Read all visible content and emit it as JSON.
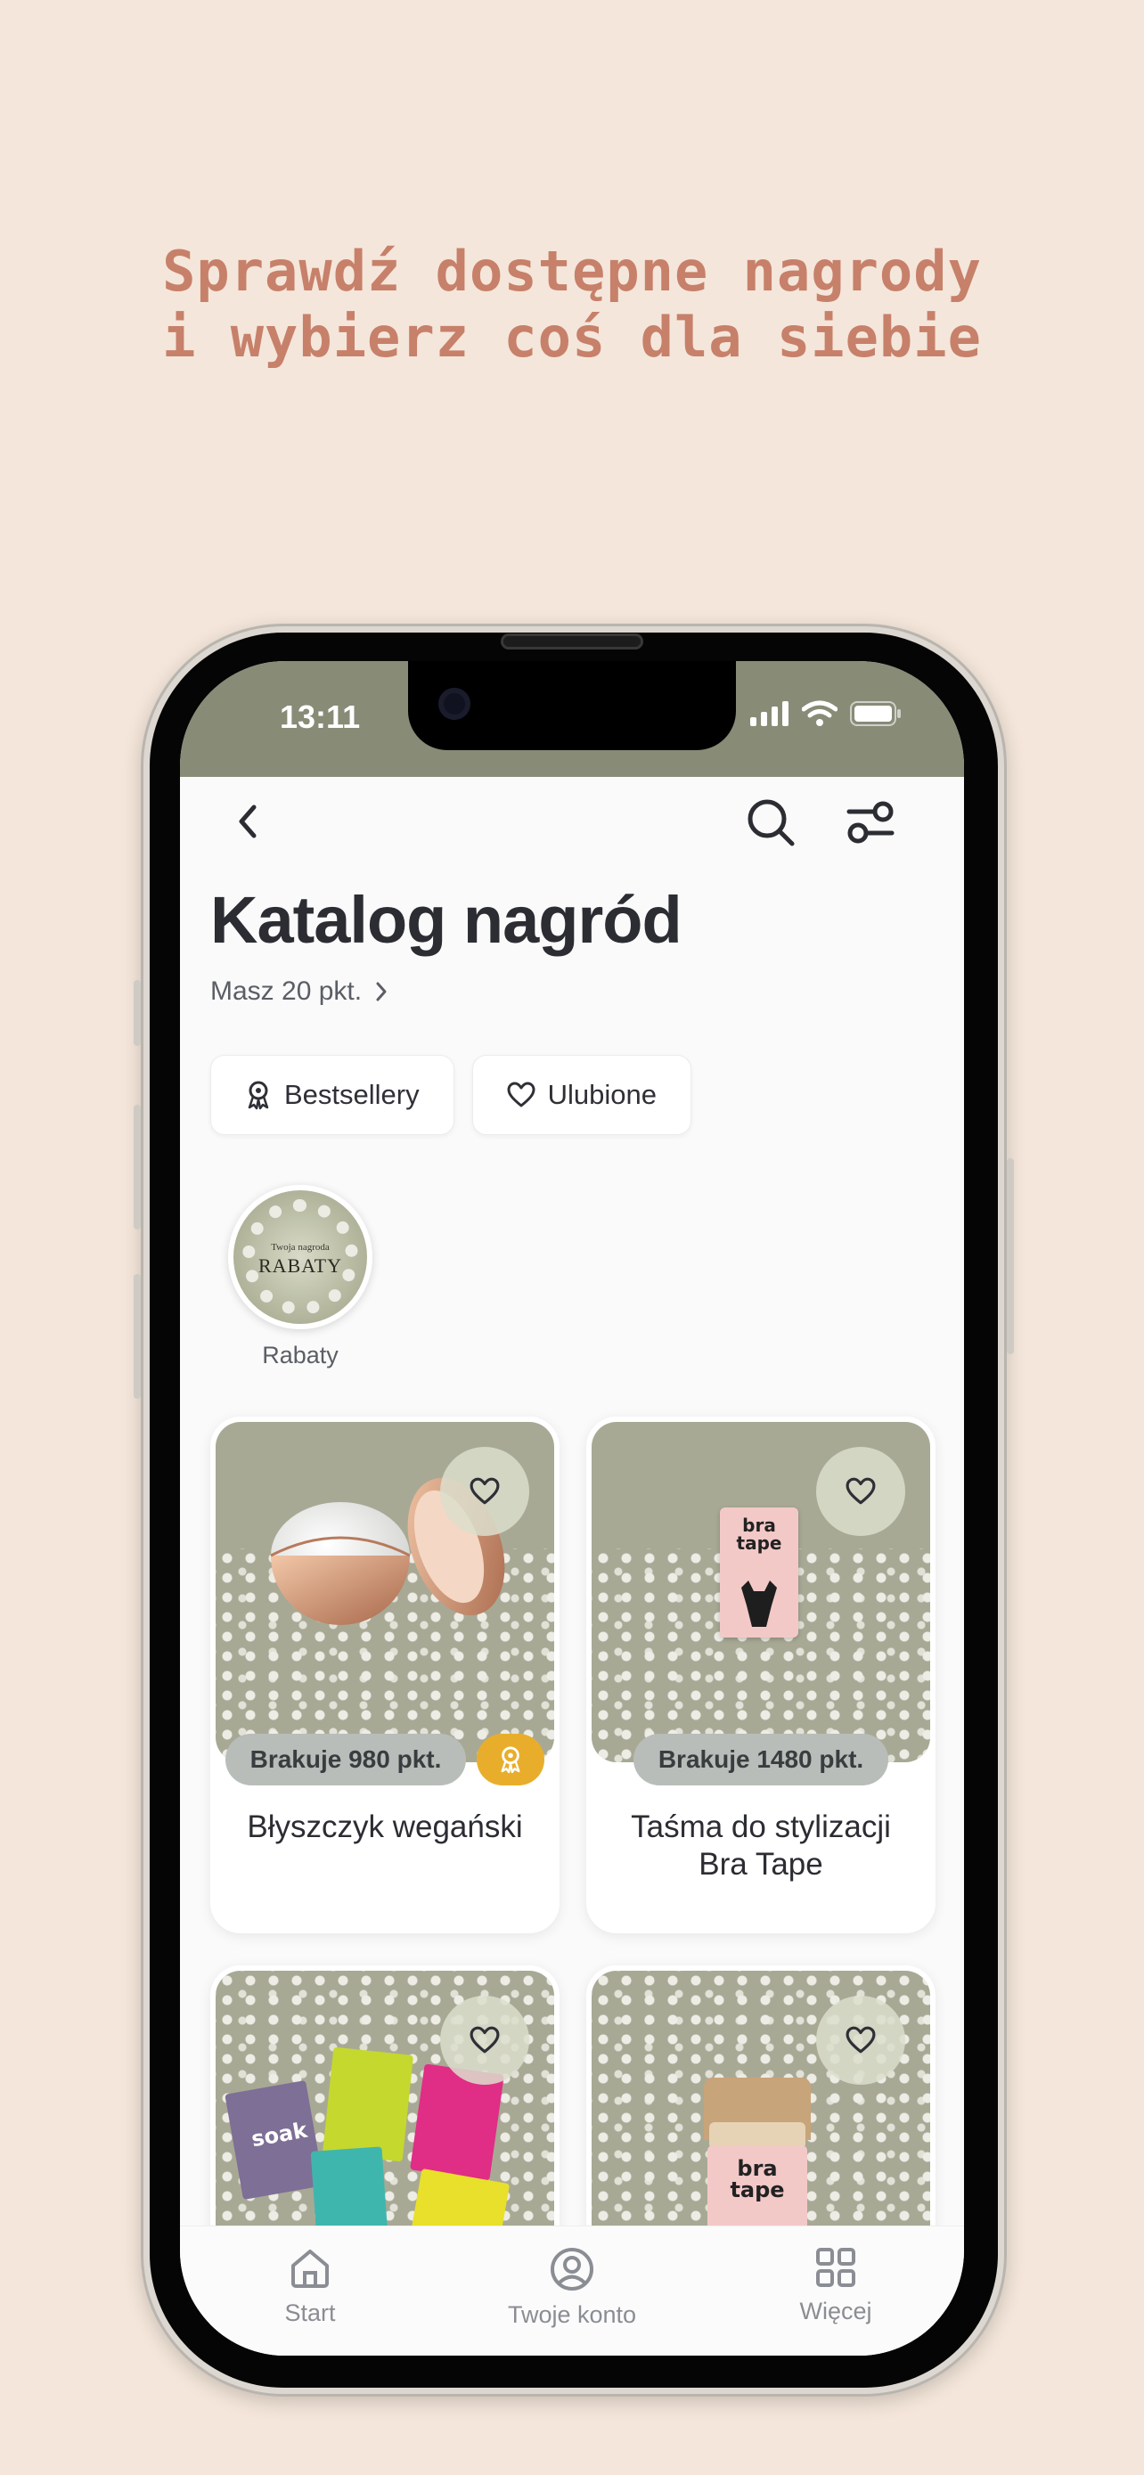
{
  "promo": {
    "line1": "Sprawdź dostępne nagrody",
    "line2": "i wybierz coś dla siebie"
  },
  "status_bar": {
    "time": "13:11"
  },
  "header": {
    "title": "Katalog nagród",
    "points_text": "Masz 20 pkt."
  },
  "filters": [
    {
      "label": "Bestsellery",
      "icon": "award-ribbon-icon"
    },
    {
      "label": "Ulubione",
      "icon": "heart-icon"
    }
  ],
  "categories": [
    {
      "label": "Rabaty",
      "image_small_text": "Twoja nagroda",
      "image_big_text": "RABATY"
    }
  ],
  "products": [
    {
      "title": "Błyszczyk wegański",
      "missing": "Brakuje 980 pkt.",
      "bestseller": true
    },
    {
      "title": "Taśma do stylizacji Bra Tape",
      "missing": "Brakuje 1480 pkt.",
      "bestseller": false
    },
    {
      "title": "",
      "missing": "",
      "bestseller": false
    },
    {
      "title": "",
      "missing": "",
      "bestseller": false
    }
  ],
  "product_art": {
    "bra_tape_box": "bra tape",
    "soak_sachet": "soak"
  },
  "bottom_nav": [
    {
      "label": "Start",
      "icon": "home-icon"
    },
    {
      "label": "Twoje konto",
      "icon": "account-icon"
    },
    {
      "label": "Więcej",
      "icon": "grid-icon"
    }
  ],
  "colors": {
    "background": "#f4e6da",
    "headline": "#c7806a",
    "status_bar": "#888b76",
    "badge_gold": "#e8ae2b"
  }
}
